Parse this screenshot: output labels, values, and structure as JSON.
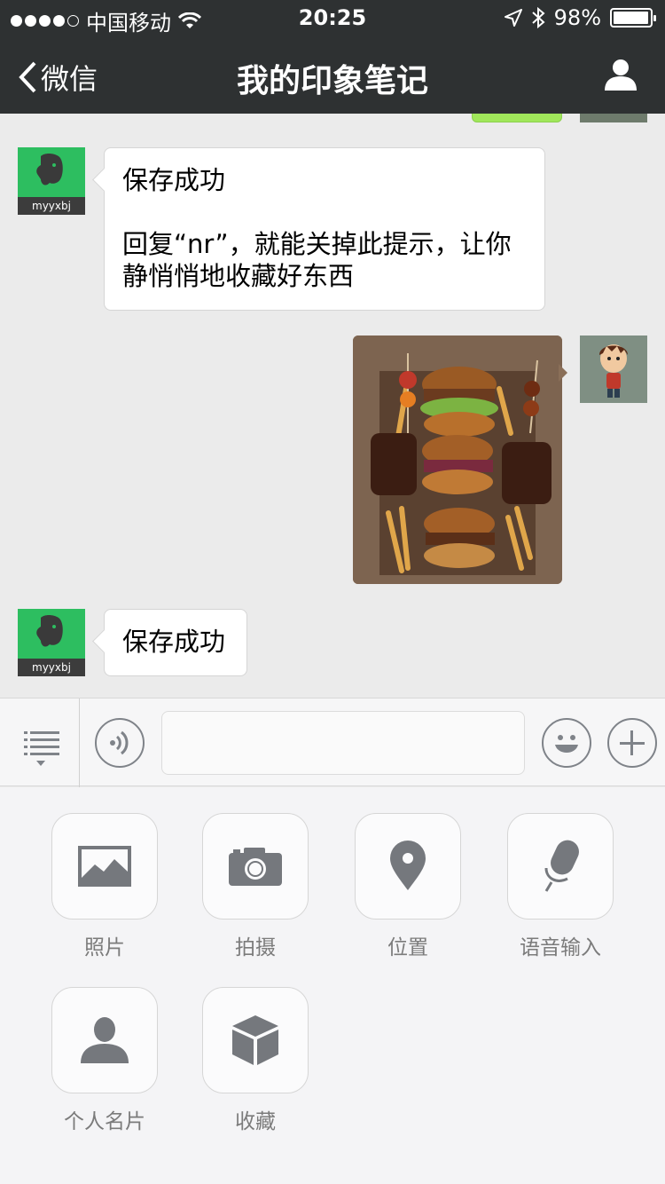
{
  "status_bar": {
    "carrier": "中国移动",
    "time": "20:25",
    "battery": "98%",
    "battery_level": 0.98
  },
  "nav": {
    "back_label": "微信",
    "title": "我的印象笔记"
  },
  "messages": [
    {
      "sender": "myyxbj",
      "title": "保存成功",
      "body": "回复“nr”，就能关掉此提示，让你静悄悄地收藏好东西"
    },
    {
      "sender": "me",
      "type": "image"
    },
    {
      "sender": "myyxbj",
      "title": "保存成功"
    }
  ],
  "evernote_avatar_label": "myyxbj",
  "input": {
    "value": "",
    "placeholder": ""
  },
  "tools": [
    {
      "label": "照片",
      "icon": "photo-icon"
    },
    {
      "label": "拍摄",
      "icon": "camera-icon"
    },
    {
      "label": "位置",
      "icon": "location-icon"
    },
    {
      "label": "语音输入",
      "icon": "microphone-icon"
    },
    {
      "label": "个人名片",
      "icon": "contact-card-icon"
    },
    {
      "label": "收藏",
      "icon": "favorites-box-icon"
    }
  ],
  "colors": {
    "nav_bg": "#2e3132",
    "evernote_green": "#2dbe60",
    "chat_bg": "#ebebeb",
    "icon_gray": "#75787d"
  }
}
